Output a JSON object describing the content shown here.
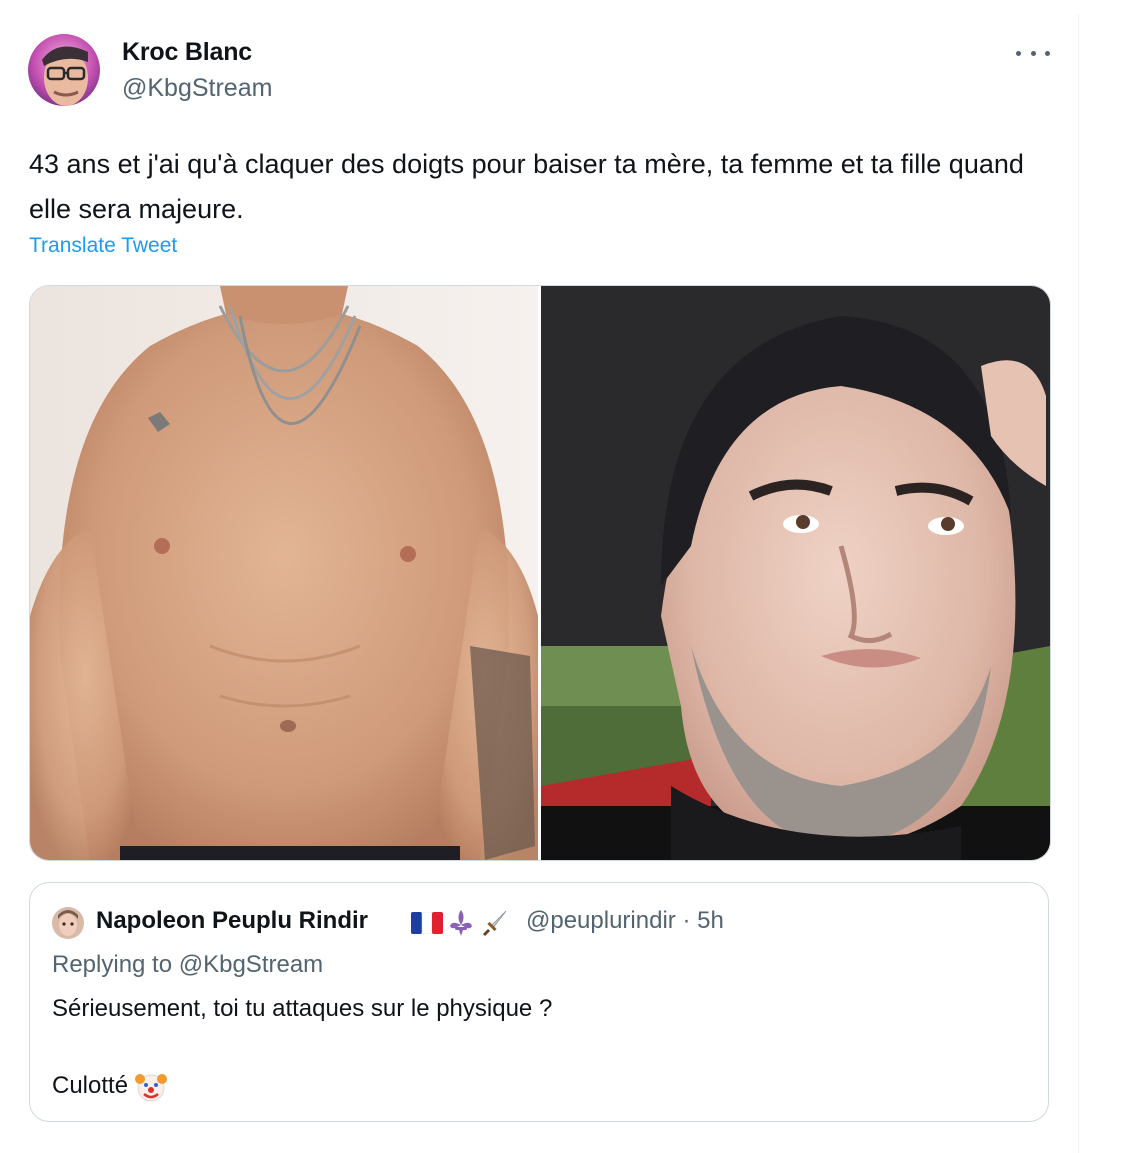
{
  "tweet": {
    "author_name": "Kroc Blanc",
    "author_handle": "@KbgStream",
    "text": "43 ans et j'ai qu'à claquer des doigts pour baiser ta mère, ta femme et ta fille quand elle sera majeure.",
    "translate_label": "Translate Tweet",
    "more_icon": "more-options-icon",
    "media": [
      {
        "name": "shirtless-torso-photo"
      },
      {
        "name": "car-selfie-photo"
      }
    ]
  },
  "quote": {
    "author_name": "Napoleon Peuplu Rindir",
    "emojis": [
      "flag-france",
      "fleur-de-lis",
      "dagger"
    ],
    "author_handle": "@peuplurindir",
    "separator": "·",
    "time": "5h",
    "replying_to": "Replying to @KbgStream",
    "line1": "Sérieusement, toi tu attaques sur le physique ?",
    "line2": "Culotté",
    "line2_emoji": "clown-face"
  },
  "colors": {
    "link": "#1d9bf0",
    "secondary_text": "#536471",
    "border": "#cfd9de"
  }
}
